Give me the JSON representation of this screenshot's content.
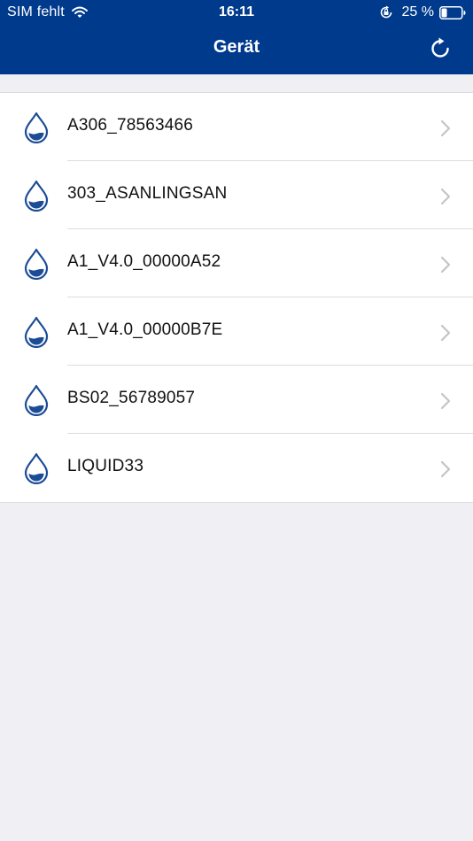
{
  "status_bar": {
    "carrier": "SIM fehlt",
    "time": "16:11",
    "battery_percent": "25 %",
    "icons": [
      "wifi-icon",
      "orientation-lock-icon",
      "battery-icon"
    ]
  },
  "nav": {
    "title": "Gerät",
    "refresh_icon": "refresh-icon"
  },
  "devices": [
    {
      "label": "A306_78563466",
      "icon": "water-drop-icon"
    },
    {
      "label": "303_ASANLINGSAN",
      "icon": "water-drop-icon"
    },
    {
      "label": "A1_V4.0_00000A52",
      "icon": "water-drop-icon"
    },
    {
      "label": "A1_V4.0_00000B7E",
      "icon": "water-drop-icon"
    },
    {
      "label": "BS02_56789057",
      "icon": "water-drop-icon"
    },
    {
      "label": "LIQUID33",
      "icon": "water-drop-icon"
    }
  ],
  "colors": {
    "nav_background": "#003a8c",
    "page_background": "#efeff4",
    "icon_blue": "#1c4c96",
    "chevron_gray": "#c4c4c9"
  }
}
